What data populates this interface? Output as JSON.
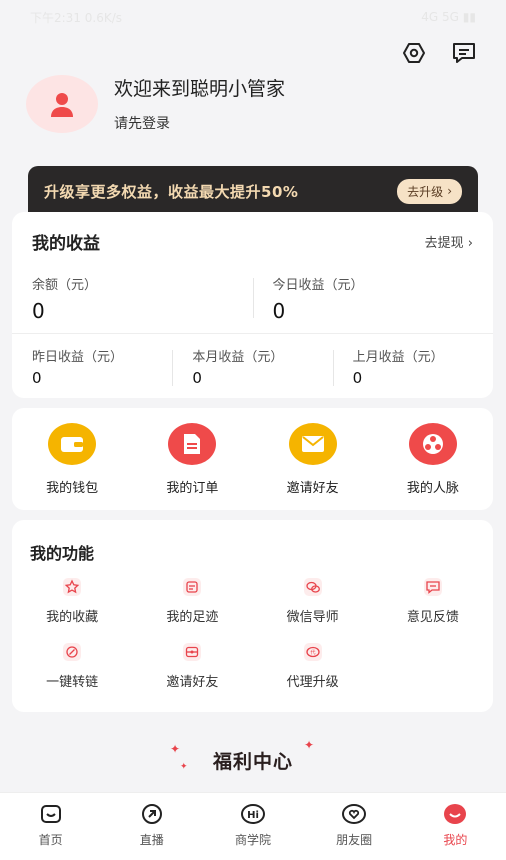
{
  "status": {
    "time": "下午2:31  0.6K/s",
    "right": "4G  5G  ▮▮"
  },
  "profile": {
    "welcome": "欢迎来到聪明小管家",
    "login": "请先登录"
  },
  "vip": {
    "text": "升级享更多权益，收益最大提升50%",
    "button": "去升级"
  },
  "earnings": {
    "title": "我的收益",
    "withdraw": "去提现",
    "balance": {
      "label": "余额（元）",
      "value": "0"
    },
    "today": {
      "label": "今日收益（元）",
      "value": "0"
    },
    "yesterday": {
      "label": "昨日收益（元）",
      "value": "0"
    },
    "month": {
      "label": "本月收益（元）",
      "value": "0"
    },
    "last_month": {
      "label": "上月收益（元）",
      "value": "0"
    }
  },
  "quick": [
    {
      "label": "我的钱包",
      "icon": "wallet-icon",
      "color": "#f5b400"
    },
    {
      "label": "我的订单",
      "icon": "order-icon",
      "color": "#ef4a4a"
    },
    {
      "label": "邀请好友",
      "icon": "mail-icon",
      "color": "#f5b400"
    },
    {
      "label": "我的人脉",
      "icon": "network-icon",
      "color": "#ef4a4a"
    }
  ],
  "functions": {
    "title": "我的功能",
    "items": [
      {
        "label": "我的收藏",
        "icon": "star-icon"
      },
      {
        "label": "我的足迹",
        "icon": "footprint-icon"
      },
      {
        "label": "微信导师",
        "icon": "wechat-icon"
      },
      {
        "label": "意见反馈",
        "icon": "feedback-icon"
      },
      {
        "label": "一键转链",
        "icon": "link-icon"
      },
      {
        "label": "邀请好友",
        "icon": "invite-icon"
      },
      {
        "label": "代理升级",
        "icon": "agent-icon"
      }
    ]
  },
  "welfare": {
    "title": "福利中心"
  },
  "tabs": [
    {
      "label": "首页",
      "icon": "home-icon"
    },
    {
      "label": "直播",
      "icon": "live-icon"
    },
    {
      "label": "商学院",
      "icon": "school-icon"
    },
    {
      "label": "朋友圈",
      "icon": "moments-icon"
    },
    {
      "label": "我的",
      "icon": "mine-icon"
    }
  ],
  "colors": {
    "accent": "#e8444c",
    "gold": "#f3d9b1",
    "dark": "#2a2828"
  }
}
